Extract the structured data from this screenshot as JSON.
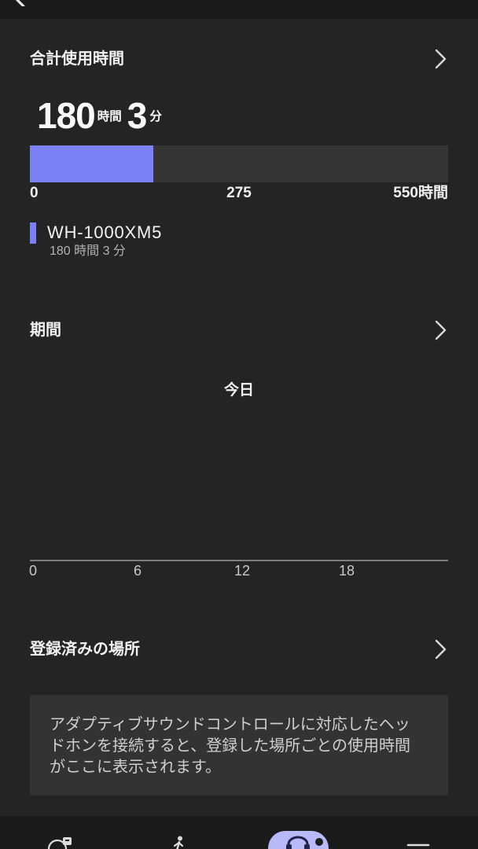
{
  "header": {
    "back_icon": "chevron-left-icon"
  },
  "total_usage": {
    "heading": "合計使用時間",
    "hours": "180",
    "hours_unit": "時間",
    "minutes": "3",
    "minutes_unit": "分",
    "bar": {
      "fill_fraction": 0.295,
      "axis_min_label": "0",
      "axis_mid_label": "275",
      "axis_max_label": "550時間"
    },
    "devices": [
      {
        "name": "WH-1000XM5",
        "usage": "180 時間 3 分"
      }
    ]
  },
  "period": {
    "heading": "期間",
    "range_label": "今日",
    "chart": {
      "x_range": [
        0,
        24
      ],
      "x_ticks": [
        0,
        6,
        12,
        18
      ]
    }
  },
  "places": {
    "heading": "登録済みの場所",
    "message_lines": [
      "アダプティブサウンドコントロールに対応したヘッ",
      "ドホンを接続すると、登録した場所ごとの使用時間",
      "がここに表示されます。"
    ]
  },
  "nav": {
    "icons": [
      "activity-icon",
      "walking-person-icon",
      "headphones-icon",
      "menu-icon"
    ],
    "active_index": 2
  },
  "icons": {
    "row_chevron": "chevron-right-icon"
  },
  "colors": {
    "accent": "#7b80f5",
    "background": "#242424",
    "bar_track": "#353535",
    "info_box": "#333333",
    "nav_background": "#1b1b1b",
    "nav_active": "#b7b9f8"
  }
}
